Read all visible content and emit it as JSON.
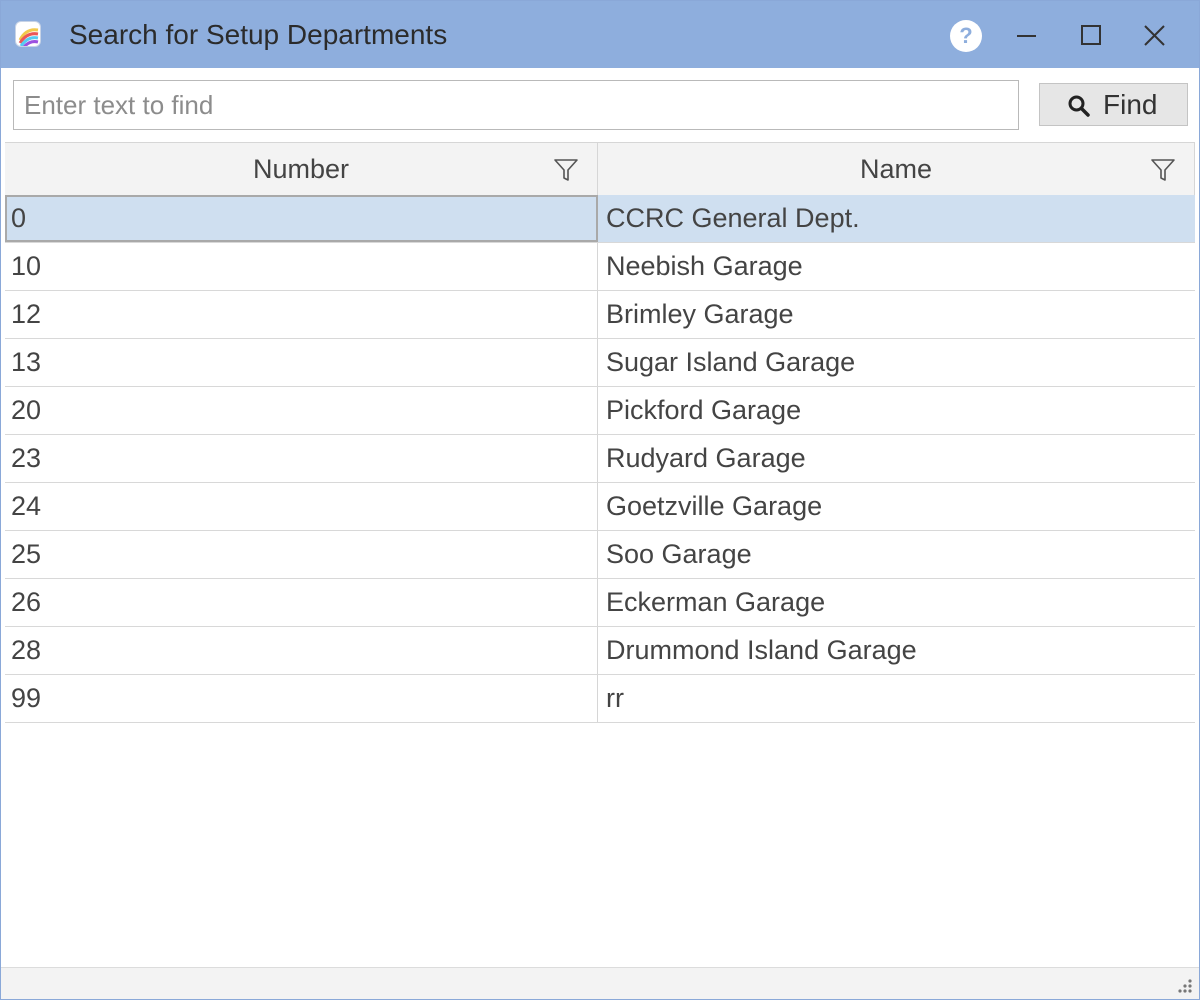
{
  "window": {
    "title": "Search for Setup Departments",
    "help_glyph": "?"
  },
  "search": {
    "value": "",
    "placeholder": "Enter text to find",
    "find_label": "Find"
  },
  "table": {
    "columns": [
      {
        "label": "Number"
      },
      {
        "label": "Name"
      }
    ],
    "selected_row_index": 0,
    "rows": [
      {
        "number": "0",
        "name": "CCRC General Dept."
      },
      {
        "number": "10",
        "name": "Neebish Garage"
      },
      {
        "number": "12",
        "name": "Brimley Garage"
      },
      {
        "number": "13",
        "name": "Sugar Island Garage"
      },
      {
        "number": "20",
        "name": "Pickford Garage"
      },
      {
        "number": "23",
        "name": "Rudyard Garage"
      },
      {
        "number": "24",
        "name": "Goetzville Garage"
      },
      {
        "number": "25",
        "name": "Soo Garage"
      },
      {
        "number": "26",
        "name": "Eckerman Garage"
      },
      {
        "number": "28",
        "name": "Drummond Island Garage"
      },
      {
        "number": "99",
        "name": "rr"
      }
    ]
  },
  "icons": {
    "app": "app-logo-icon",
    "help": "help-icon",
    "minimize": "minimize-icon",
    "maximize": "maximize-icon",
    "close": "close-icon",
    "search": "search-icon",
    "filter": "filter-icon",
    "grip": "resize-grip-icon"
  },
  "colors": {
    "titlebar": "#8eaedd",
    "selected_row": "#cfdff0",
    "header_bg": "#f3f3f3"
  }
}
